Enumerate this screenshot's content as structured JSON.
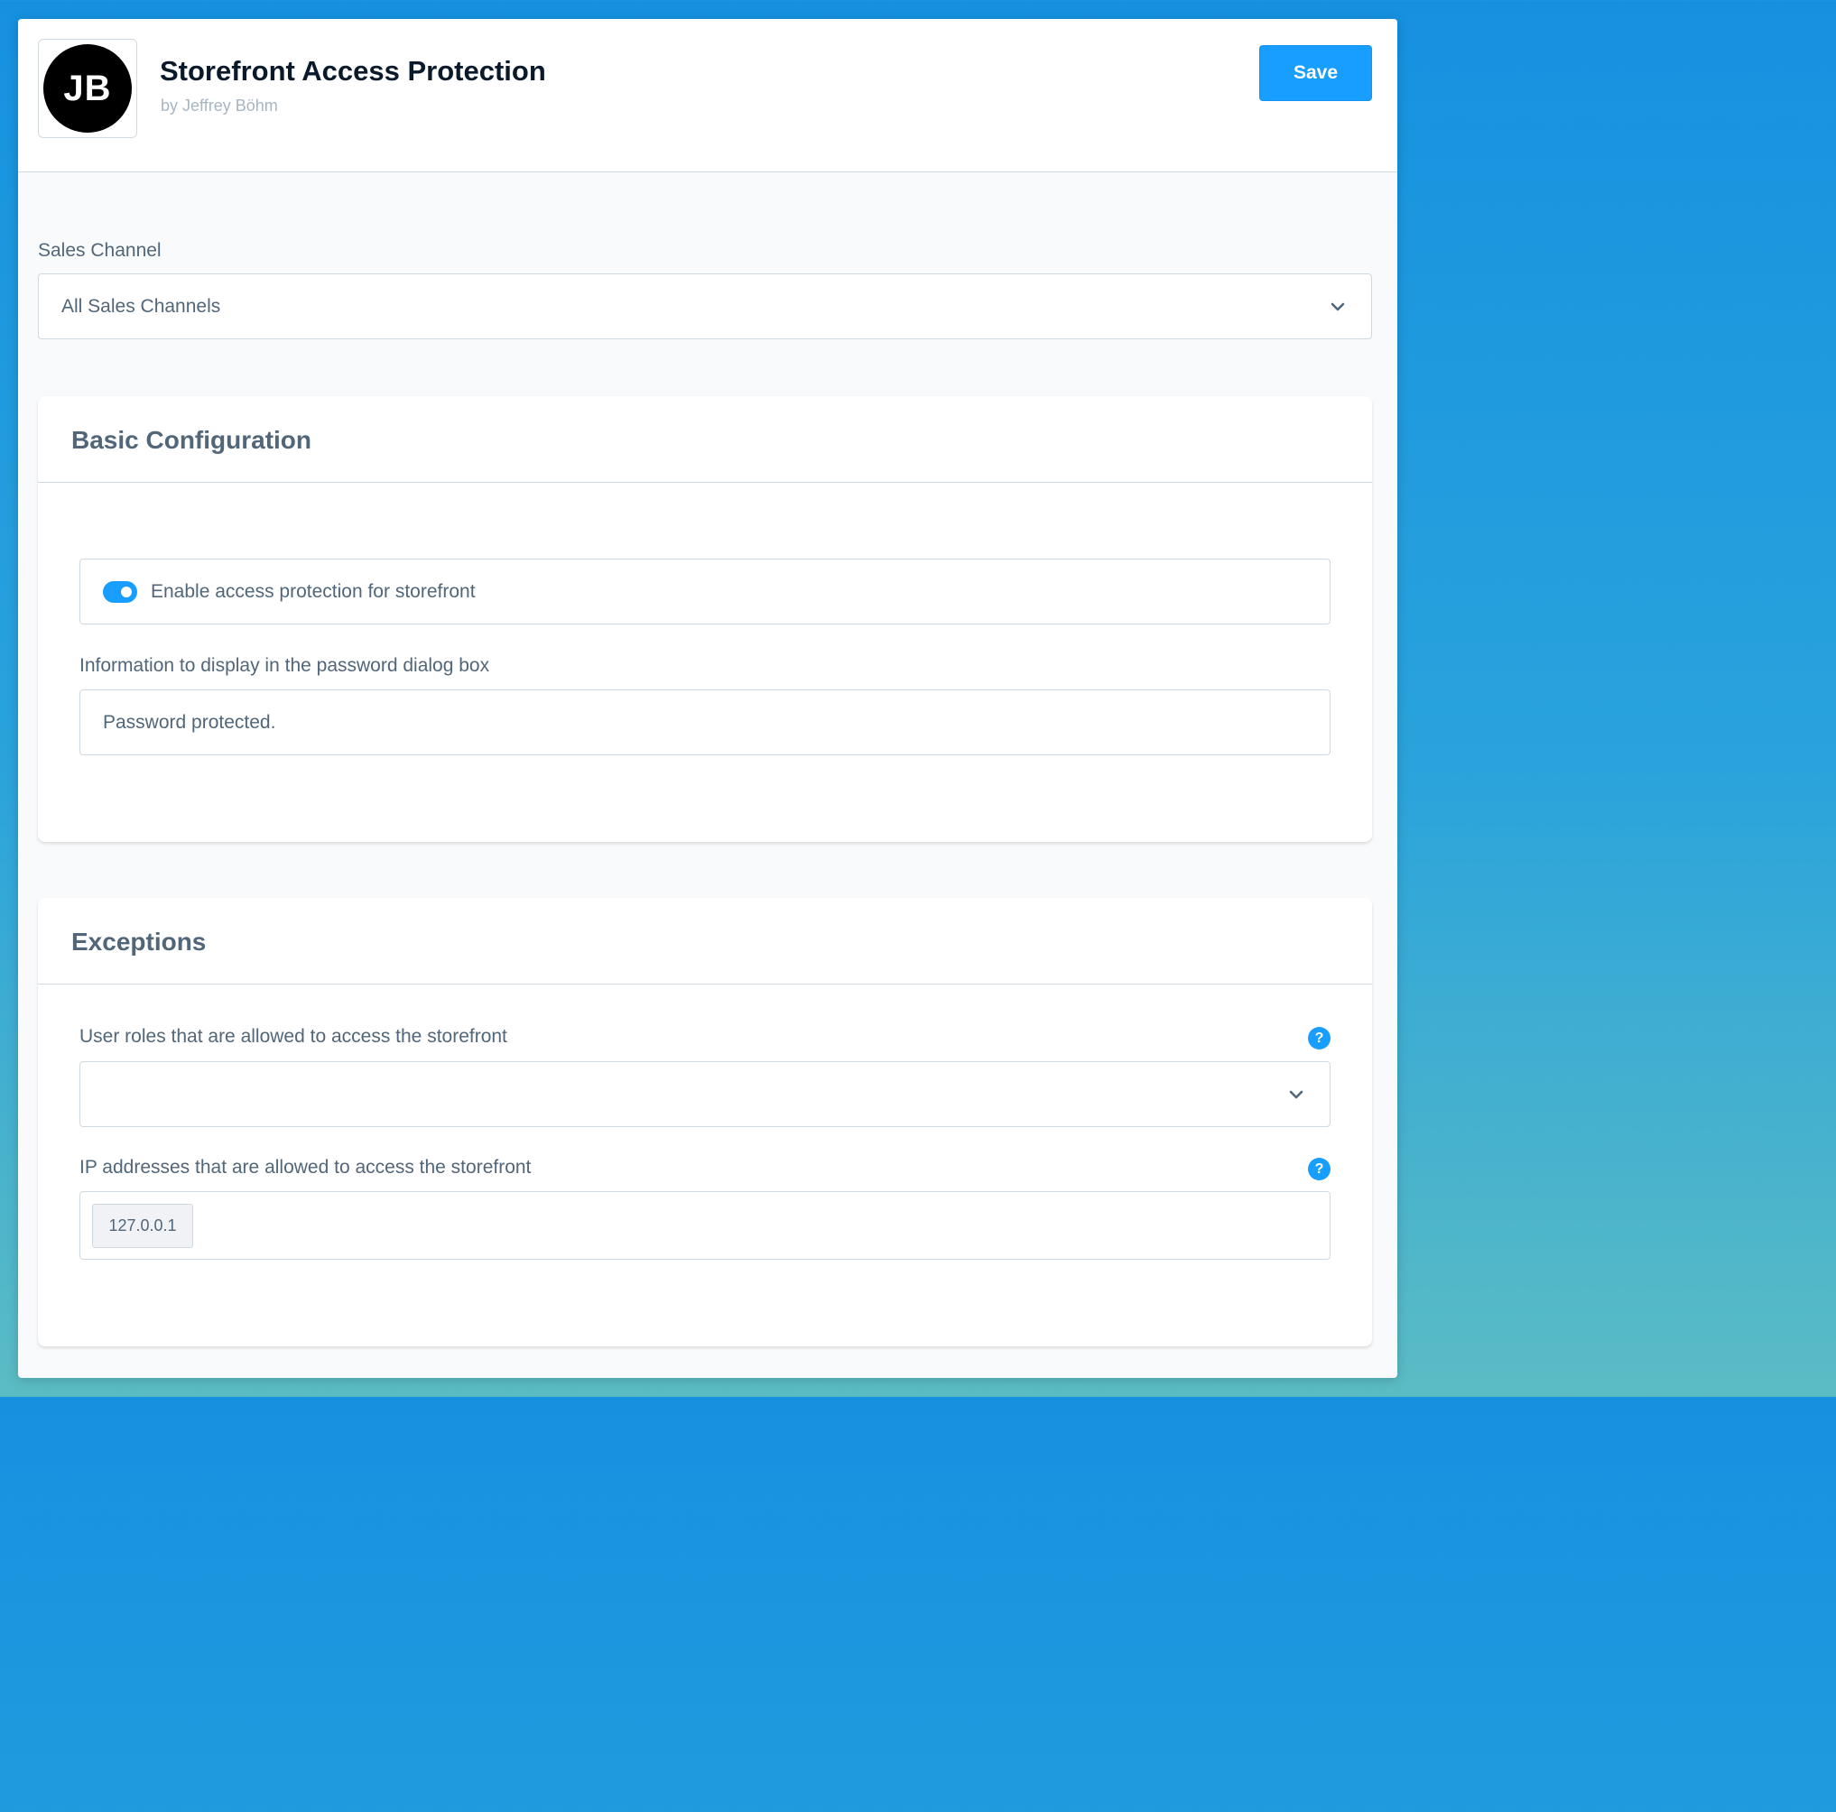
{
  "header": {
    "logo_text": "JB",
    "title": "Storefront Access Protection",
    "author": "by Jeffrey Böhm",
    "save_label": "Save"
  },
  "sales_channel": {
    "label": "Sales Channel",
    "selected": "All Sales Channels"
  },
  "basic_config": {
    "title": "Basic Configuration",
    "enable_toggle": {
      "label": "Enable access protection for storefront",
      "checked": true
    },
    "info_field": {
      "label": "Information to display in the password dialog box",
      "value": "Password protected."
    }
  },
  "exceptions": {
    "title": "Exceptions",
    "user_roles": {
      "label": "User roles that are allowed to access the storefront",
      "selected": ""
    },
    "ip_addresses": {
      "label": "IP addresses that are allowed to access the storefront",
      "tags": [
        "127.0.0.1"
      ]
    },
    "help_glyph": "?"
  },
  "colors": {
    "accent": "#189eff",
    "text": "#52667a",
    "title_text": "#0b1a2b",
    "border": "#d1d9e0",
    "background": "#f9fafb"
  },
  "icons": [
    "chevron-down-icon",
    "help-icon"
  ]
}
